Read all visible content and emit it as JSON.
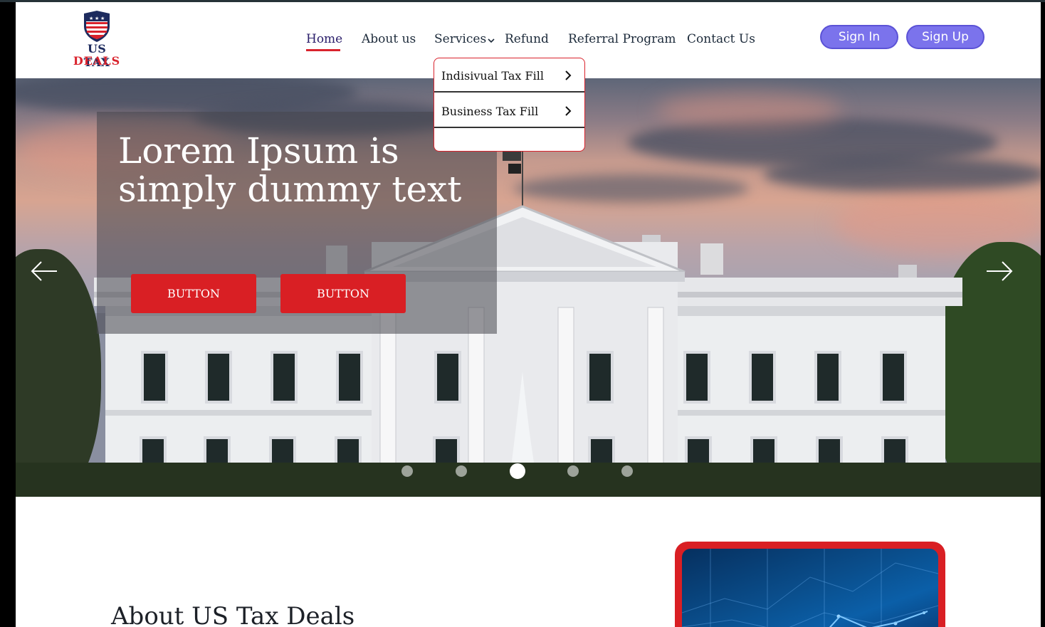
{
  "brand": {
    "line1": "US TAX",
    "line2": "DEALS",
    "colors": {
      "navy": "#1d2b5e",
      "red": "#d9232d"
    }
  },
  "nav": {
    "items": [
      {
        "label": "Home",
        "active": true
      },
      {
        "label": "About us"
      },
      {
        "label": "Services",
        "has_dropdown": true
      },
      {
        "label": "Refund"
      },
      {
        "label": "Referral Program"
      },
      {
        "label": "Contact Us"
      }
    ]
  },
  "auth": {
    "sign_in": "Sign In",
    "sign_up": "Sign Up",
    "accent": "#7b73ec"
  },
  "services_menu": {
    "items": [
      {
        "label": "Indisivual Tax Fill",
        "icon": "chevron-right-icon"
      },
      {
        "label": "Business Tax Fill",
        "icon": "chevron-right-icon"
      }
    ]
  },
  "hero": {
    "title": "Lorem Ipsum is simply dummy text",
    "buttons": [
      "BUTTON",
      "BUTTON"
    ],
    "button_color": "#d91f24",
    "prev_icon": "arrow-left-icon",
    "next_icon": "arrow-right-icon",
    "slides_count": 5,
    "active_slide": 3
  },
  "about": {
    "title": "About US Tax Deals"
  }
}
